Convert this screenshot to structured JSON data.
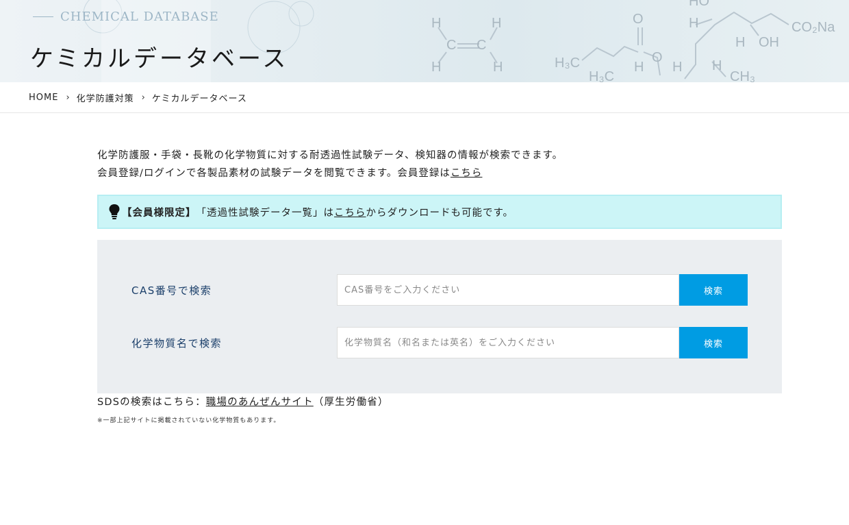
{
  "hero": {
    "subtitle": "CHEMICAL DATABASE",
    "title": "ケミカルデータベース"
  },
  "breadcrumb": {
    "items": [
      "HOME",
      "化学防護対策",
      "ケミカルデータベース"
    ],
    "separator": "›"
  },
  "intro": {
    "line1": "化学防護服・手袋・長靴の化学物質に対する耐透過性試験データ、検知器の情報が検索できます。",
    "line2_text": "会員登録/ログインで各製品素材の試験データを閲覧できます。会員登録は",
    "line2_link": "こちら"
  },
  "notice": {
    "icon": "lightbulb-icon",
    "strong": "【会員様限定】",
    "text_before": "「透過性試験データ一覧」は",
    "link": "こちら",
    "text_after": "からダウンロードも可能です。"
  },
  "search": {
    "cas": {
      "label": "CAS番号で検索",
      "placeholder": "CAS番号をご入力ください",
      "value": "",
      "button": "検索"
    },
    "name": {
      "label": "化学物質名で検索",
      "placeholder": "化学物質名（和名または英名）をご入力ください",
      "value": "",
      "button": "検索"
    }
  },
  "sds": {
    "text_before": "SDSの検索はこちら：",
    "link": "職場のあんぜんサイト",
    "text_after": "（厚生労働省）"
  },
  "note": "※一部上記サイトに掲載されていない化学物質もあります。",
  "colors": {
    "accent_button": "#009ce3",
    "notice_bg": "#ccf5f7",
    "panel_bg": "#ebeef1",
    "label_color": "#1b3f6a"
  }
}
